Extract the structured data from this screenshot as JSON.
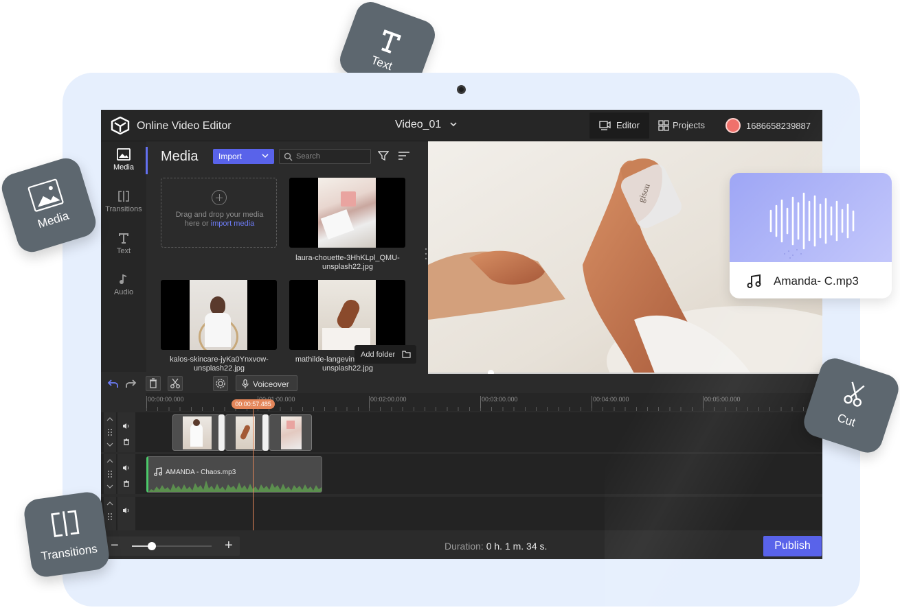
{
  "header": {
    "app_title": "Online Video Editor",
    "project_title": "Video_01",
    "tabs": [
      {
        "label": "Editor",
        "active": true
      },
      {
        "label": "Projects",
        "active": false
      }
    ],
    "user_id": "1686658239887"
  },
  "sidebar": {
    "items": [
      {
        "label": "Media",
        "icon": "image-icon",
        "active": true
      },
      {
        "label": "Transitions",
        "icon": "transitions-icon",
        "active": false
      },
      {
        "label": "Text",
        "icon": "text-icon",
        "active": false
      },
      {
        "label": "Audio",
        "icon": "music-note-icon",
        "active": false
      }
    ]
  },
  "media_panel": {
    "title": "Media",
    "import_label": "Import",
    "search_placeholder": "Search",
    "dropzone_text": "Drag and drop your media here or",
    "dropzone_link": "import media",
    "files": [
      {
        "name": "laura-chouette-3HhKLpl_QMU-unsplash22.jpg"
      },
      {
        "name": "kalos-skincare-jyKa0Ynxvow-unsplash22.jpg"
      },
      {
        "name": "mathilde-langevin-uk5T7ligYZI-unsplash22.jpg"
      }
    ],
    "add_folder_label": "Add folder"
  },
  "timeline": {
    "voiceover_label": "Voiceover",
    "ruler_labels": [
      "00:00:00.000",
      "00:01:00.000",
      "00:02:00.000",
      "00:03:00.000",
      "00:04:00.000",
      "00:05:00.000"
    ],
    "playhead_time": "00:00:57.485",
    "audio_clip_name": "AMANDA - Chaos.mp3"
  },
  "footer": {
    "zoom_level": 0.25,
    "duration_label": "Duration:",
    "duration_value": "0 h. 1 m. 34 s.",
    "publish_label": "Publish"
  },
  "floating_cards": {
    "text": "Text",
    "media": "Media",
    "cut": "Cut",
    "transitions": "Transitions",
    "audio_file": "Amanda- C.mp3"
  },
  "colors": {
    "accent": "#5963ea",
    "playhead": "#e4865a",
    "audio_track": "#4cc96a",
    "tablet_bg": "#e6effd"
  }
}
